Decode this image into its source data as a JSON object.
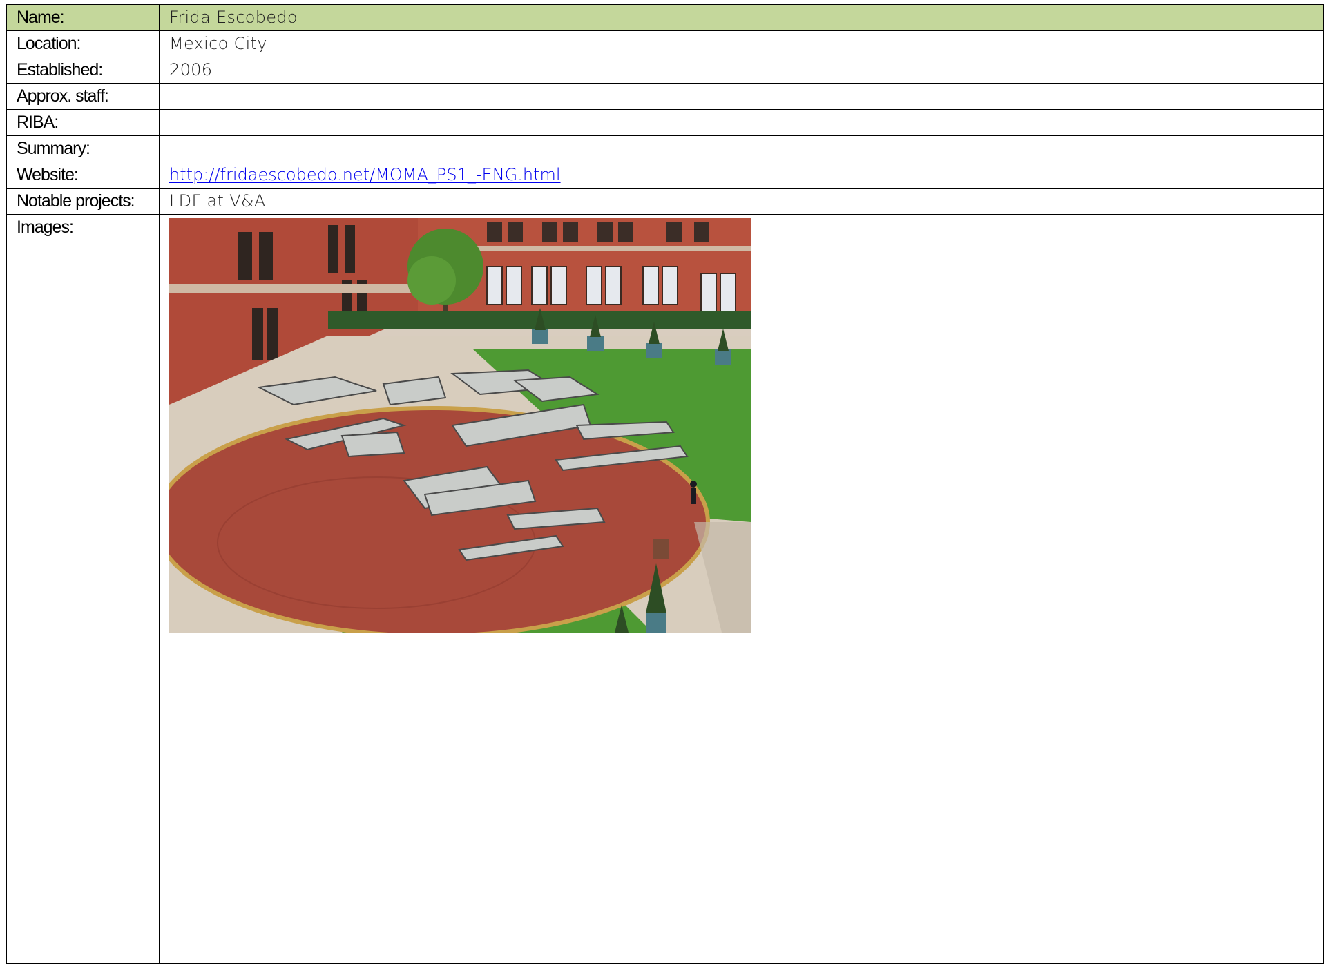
{
  "rows": {
    "name": {
      "label": "Name:",
      "value": "Frida Escobedo"
    },
    "location": {
      "label": "Location:",
      "value": "Mexico City"
    },
    "established": {
      "label": "Established:",
      "value": "2006"
    },
    "staff": {
      "label": "Approx. staff:",
      "value": ""
    },
    "riba": {
      "label": "RIBA:",
      "value": ""
    },
    "summary": {
      "label": "Summary:",
      "value": ""
    },
    "website": {
      "label": "Website:",
      "value": "http://fridaescobedo.net/MOMA_PS1_-ENG.html"
    },
    "projects": {
      "label": "Notable projects:",
      "value": "LDF at V&A"
    },
    "images": {
      "label": "Images:"
    }
  },
  "colors": {
    "header_background": "#c4d79b",
    "link": "#0000ee",
    "border": "#000000"
  }
}
